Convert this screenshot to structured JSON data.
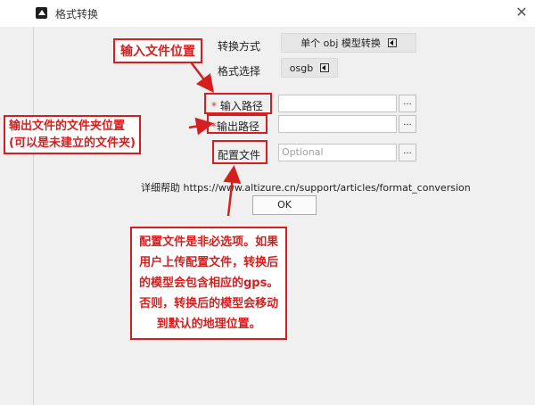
{
  "window": {
    "title": "格式转换",
    "close_glyph": "✕"
  },
  "form": {
    "convert_mode_label": "转换方式",
    "convert_mode_value": "单个 obj 模型转换",
    "format_label": "格式选择",
    "format_value": "osgb",
    "input_label": "输入路径",
    "output_label": "输出路径",
    "config_label": "配置文件",
    "config_placeholder": "Optional",
    "browse_label": "...",
    "required_mark": "*",
    "help_prefix": "详细帮助",
    "help_url": "https://www.altizure.cn/support/articles/format_conversion",
    "ok_label": "OK"
  },
  "annotations": {
    "input_note": "输入文件位置",
    "output_note_line1": "输出文件的文件夹位置",
    "output_note_line2": "(可以是未建立的文件夹)",
    "config_note_line1": "配置文件是非必选项。如果",
    "config_note_line2": "用户上传配置文件，转换后",
    "config_note_line3": "的模型会包含相应的gps。",
    "config_note_line4": "否则，转换后的模型会移动",
    "config_note_line5": "到默认的地理位置。"
  },
  "colors": {
    "annotation_red": "#d61e1e",
    "window_bg": "#f0f0f0"
  }
}
